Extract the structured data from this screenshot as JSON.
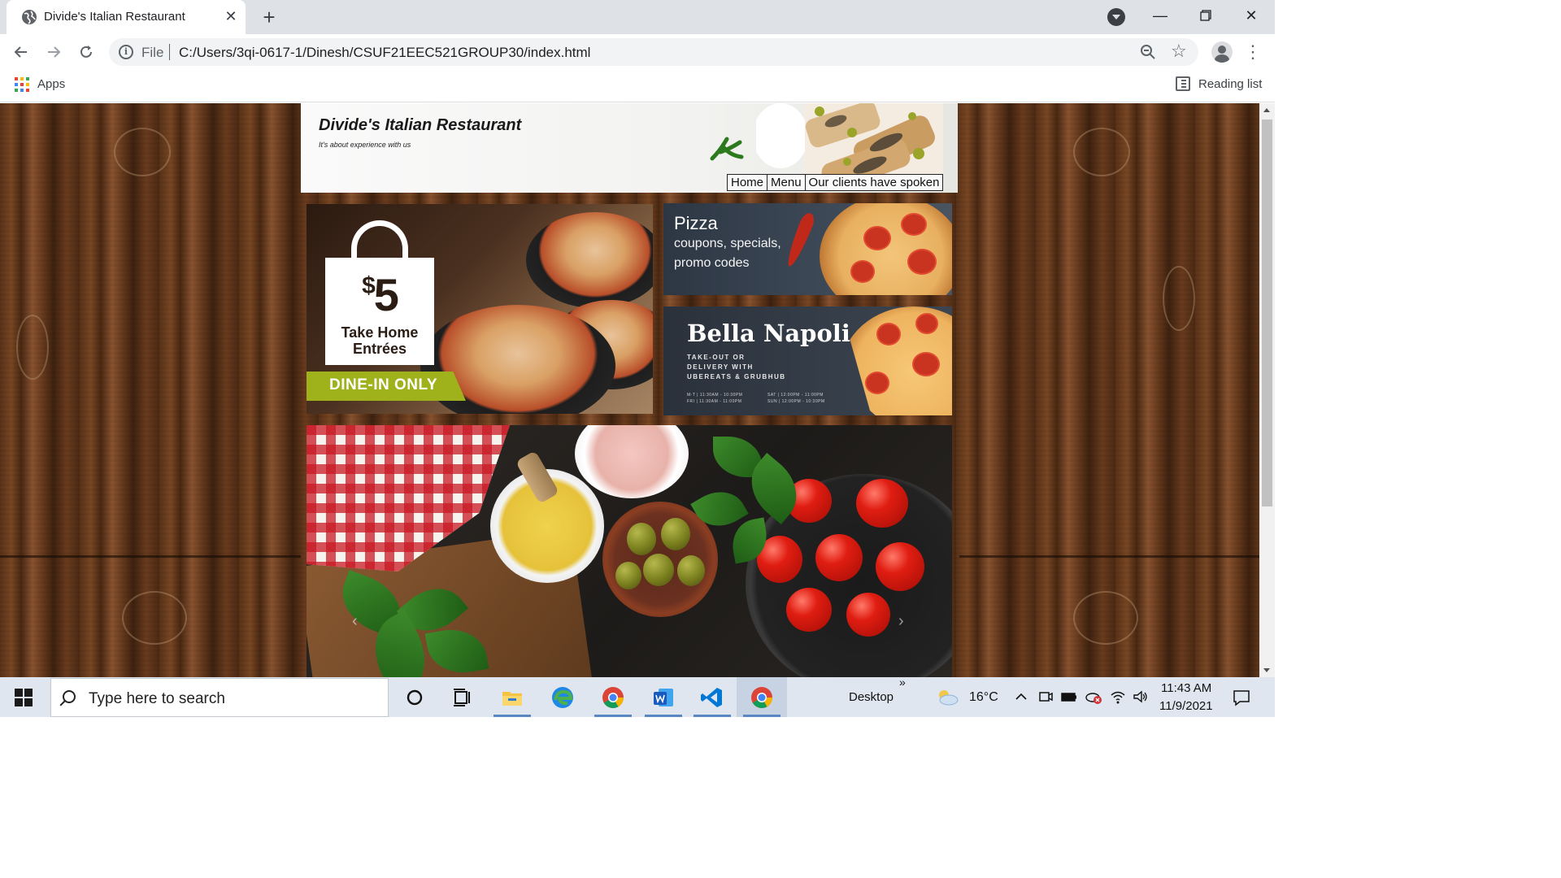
{
  "browser": {
    "tab_title": "Divide's Italian Restaurant",
    "tab_close": "✕",
    "new_tab": "+",
    "url_scheme": "File",
    "url": "C:/Users/3qi-0617-1/Dinesh/CSUF21EEC521GROUP30/index.html",
    "bookmarks_apps": "Apps",
    "reading_list": "Reading list",
    "icons": [
      "globe-icon",
      "back-icon",
      "forward-icon",
      "reload-icon",
      "info-icon",
      "zoom-icon",
      "star-icon",
      "profile-icon",
      "menu-icon",
      "apps-icon",
      "reading-list-icon"
    ]
  },
  "site": {
    "title": "Divide's Italian Restaurant",
    "tagline": "It's about experience with us",
    "nav": [
      "Home",
      "Menu",
      "Our clients have spoken"
    ]
  },
  "promo_take_home": {
    "price_symbol": "$",
    "price": "5",
    "line1": "Take Home",
    "line2": "Entrées",
    "banner": "DINE-IN ONLY"
  },
  "promo_pizza": {
    "title": "Pizza",
    "line1": "coupons, specials,",
    "line2": "promo codes"
  },
  "promo_napoli": {
    "title": "Bella Napoli",
    "line1": "TAKE-OUT OR",
    "line2": "DELIVERY WITH",
    "line3": "UBEREATS & GRUBHUB",
    "hours_1a": "M-T | 11:30AM - 10:30PM",
    "hours_1b": "FRI | 11:30AM - 11:00PM",
    "hours_2a": "SAT | 12:00PM - 11:00PM",
    "hours_2b": "SUN | 12:00PM - 10:30PM"
  },
  "carousel": {
    "prev": "‹",
    "next": "›"
  },
  "taskbar": {
    "search_placeholder": "Type here to search",
    "desktop_label": "Desktop",
    "overflow": "»",
    "temperature": "16°C",
    "time": "11:43 AM",
    "date": "11/9/2021"
  },
  "colors": {
    "accent_green": "#9fb21c",
    "tomato_red": "#e01d12",
    "wood_dark": "#4a2812"
  }
}
